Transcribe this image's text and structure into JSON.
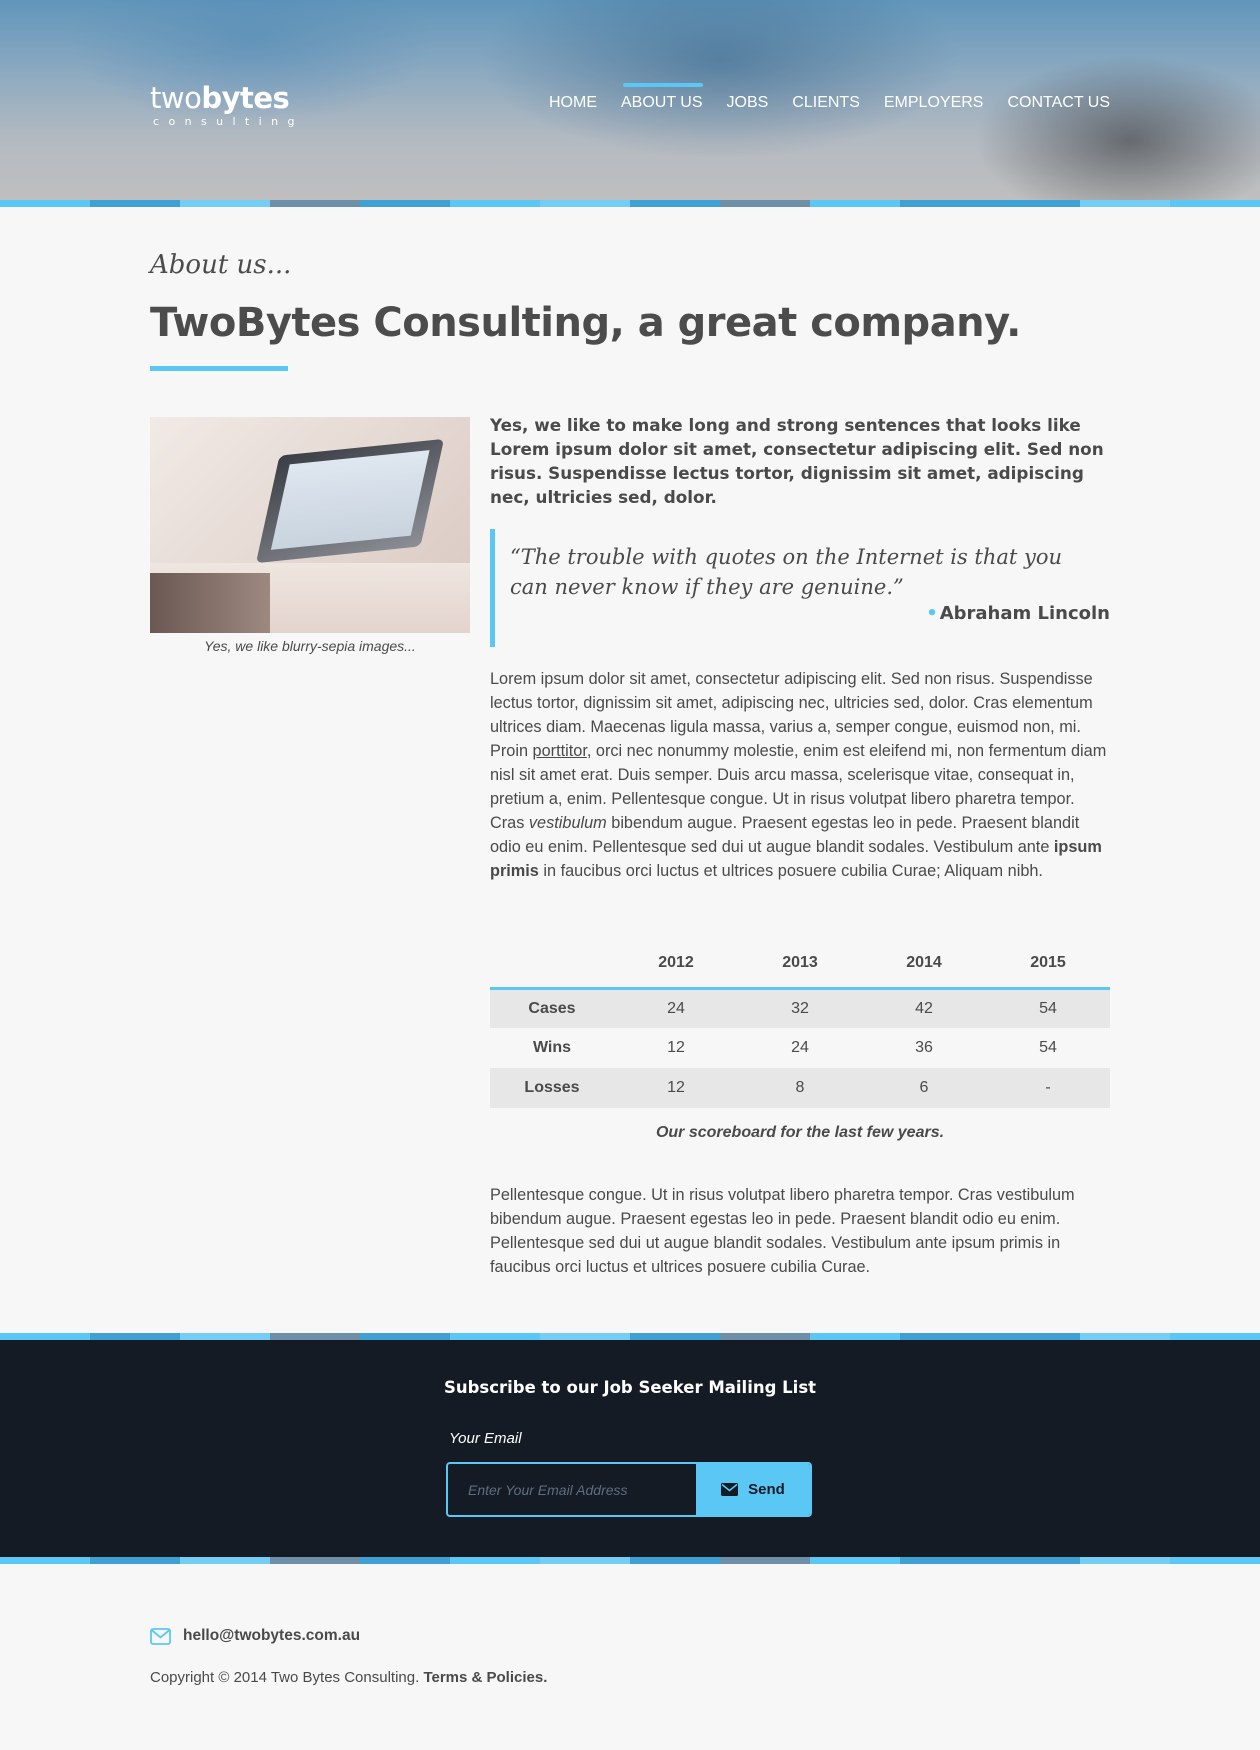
{
  "colors": {
    "accent": "#5bc7f5",
    "dark": "#141b25",
    "text": "#4a4a4a",
    "background": "#f7f7f7"
  },
  "logo": {
    "light": "two",
    "bold": "bytes",
    "sub": "consulting"
  },
  "nav": [
    {
      "label": "HOME"
    },
    {
      "label": "ABOUT US"
    },
    {
      "label": "JOBS"
    },
    {
      "label": "CLIENTS"
    },
    {
      "label": "EMPLOYERS"
    },
    {
      "label": "CONTACT US"
    }
  ],
  "nav_active": "ABOUT US",
  "page": {
    "kicker": "About us...",
    "title": "TwoBytes Consulting, a great company."
  },
  "image": {
    "caption": "Yes, we like blurry-sepia images..."
  },
  "lead": "Yes, we like to make long and strong sentences that looks like Lorem ipsum dolor sit amet, consectetur adipiscing elit. Sed non risus. Suspendisse lectus tortor, dignissim sit amet, adipiscing nec, ultricies sed, dolor.",
  "quote": {
    "text": "“The trouble with quotes on the Internet is that you can never know if they are genuine.”",
    "author": "Abraham Lincoln"
  },
  "body": {
    "p1_a": "Lorem ipsum dolor sit amet, consectetur adipiscing elit. Sed non risus. Suspendisse lectus tortor, dignissim sit amet, adipiscing nec, ultricies sed, dolor. Cras elementum ultrices diam. Maecenas ligula massa, varius a, semper congue, euismod non, mi. Proin ",
    "p1_link": "porttitor",
    "p1_b": ", orci nec nonummy molestie, enim est eleifend mi, non fermentum diam nisl sit amet erat. Duis semper. Duis arcu massa, scelerisque vitae, consequat in, pretium a, enim. Pellentesque congue. Ut in risus volutpat libero pharetra tempor. Cras ",
    "p1_italic": "vestibulum",
    "p1_c": " bibendum augue. Praesent egestas leo in pede. Praesent blandit odio eu enim. Pellentesque sed dui ut augue blandit sodales. Vestibulum ante ",
    "p1_bold": "ipsum primis",
    "p1_d": " in faucibus orci luctus et ultrices posuere cubilia Curae; Aliquam nibh.",
    "p2": "Pellentesque congue. Ut in risus volutpat libero pharetra tempor. Cras vestibulum bibendum augue. Praesent egestas leo in pede. Praesent blandit odio eu enim. Pellentesque sed dui ut augue blandit sodales. Vestibulum ante ipsum primis in faucibus orci luctus et ultrices posuere cubilia Curae."
  },
  "scoreboard": {
    "columns": [
      "",
      "2012",
      "2013",
      "2014",
      "2015"
    ],
    "rows": [
      {
        "label": "Cases",
        "values": [
          "24",
          "32",
          "42",
          "54"
        ]
      },
      {
        "label": "Wins",
        "values": [
          "12",
          "24",
          "36",
          "54"
        ]
      },
      {
        "label": "Losses",
        "values": [
          "12",
          "8",
          "6",
          "-"
        ]
      }
    ],
    "caption": "Our scoreboard for the last few years."
  },
  "subscribe": {
    "title": "Subscribe to our Job Seeker Mailing List",
    "label": "Your Email",
    "placeholder": "Enter Your Email Address",
    "button": "Send"
  },
  "footer": {
    "email": "hello@twobytes.com.au",
    "copyright": "Copyright © 2014 Two Bytes Consulting.",
    "terms": "Terms & Policies."
  }
}
